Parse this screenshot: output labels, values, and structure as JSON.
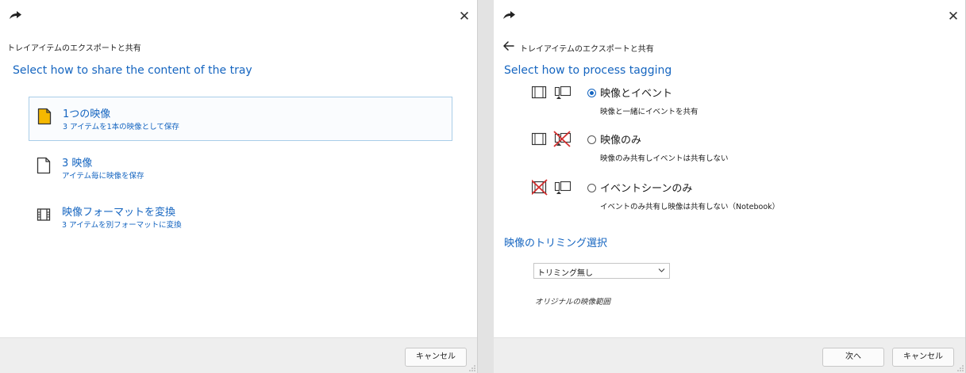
{
  "left_dialog": {
    "title": "トレイアイテムのエクスポートと共有",
    "prompt": "Select how to share the content of the tray",
    "options": [
      {
        "title": "1つの映像",
        "subtitle": "3 アイテムを1本の映像として保存",
        "icon": "document-icon",
        "icon_color": "#f5b800",
        "selected": true
      },
      {
        "title": "3 映像",
        "subtitle": "アイテム毎に映像を保存",
        "icon": "document-icon",
        "selected": false
      },
      {
        "title": "映像フォーマットを変換",
        "subtitle": "3 アイテムを別フォーマットに変換",
        "icon": "film-icon",
        "selected": false
      }
    ],
    "cancel_label": "キャンセル"
  },
  "right_dialog": {
    "title": "トレイアイテムのエクスポートと共有",
    "prompt": "Select how to process tagging",
    "tagging_options": [
      {
        "label": "映像とイベント",
        "description": "映像と一緒にイベントを共有",
        "checked": true
      },
      {
        "label": "映像のみ",
        "description": "映像のみ共有しイベントは共有しない",
        "checked": false
      },
      {
        "label": "イベントシーンのみ",
        "description": "イベントのみ共有し映像は共有しない（Notebook）",
        "checked": false
      }
    ],
    "trimming_heading": "映像のトリミング選択",
    "trimming_select": {
      "selected": "トリミング無し"
    },
    "trimming_note": "オリジナルの映像範囲",
    "next_label": "次へ",
    "cancel_label": "キャンセル"
  },
  "colors": {
    "accent": "#1565c0",
    "selected_border": "#a9cde8",
    "cross_red": "#d32f2f",
    "footer_bg": "#eeeeee"
  }
}
